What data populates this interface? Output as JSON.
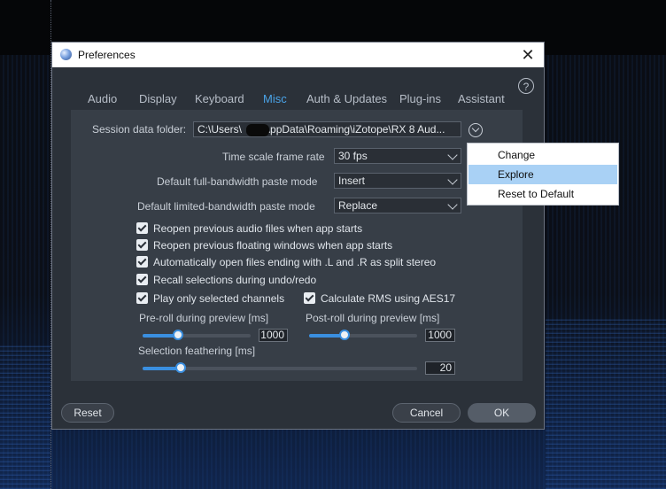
{
  "dialog": {
    "title": "Preferences",
    "close_glyph": "✕",
    "help_glyph": "?",
    "tabs": [
      {
        "label": "Audio"
      },
      {
        "label": "Display"
      },
      {
        "label": "Keyboard"
      },
      {
        "label": "Misc",
        "active": true
      },
      {
        "label": "Auth & Updates"
      },
      {
        "label": "Plug-ins"
      },
      {
        "label": "Assistant"
      }
    ]
  },
  "misc": {
    "session_folder_label": "Session data folder:",
    "session_folder_value_pre": "C:\\Users\\",
    "session_folder_value_post": "AppData\\Roaming\\iZotope\\RX 8 Aud...",
    "time_scale_label": "Time scale frame rate",
    "time_scale_value": "30 fps",
    "full_bw_label": "Default full-bandwidth paste mode",
    "full_bw_value": "Insert",
    "limited_bw_label": "Default limited-bandwidth paste mode",
    "limited_bw_value": "Replace",
    "checkboxes": [
      {
        "label": "Reopen previous audio files when app starts",
        "checked": true
      },
      {
        "label": "Reopen previous floating windows when app starts",
        "checked": true
      },
      {
        "label": "Automatically open files ending with .L and .R as split stereo",
        "checked": true
      },
      {
        "label": "Recall selections during undo/redo",
        "checked": true
      },
      {
        "label": "Play only selected channels",
        "checked": true
      },
      {
        "label": "Calculate RMS using AES17",
        "checked": true
      }
    ],
    "preroll_label": "Pre-roll during preview [ms]",
    "preroll_value": "1000",
    "preroll_fraction": 0.33,
    "postroll_label": "Post-roll during preview [ms]",
    "postroll_value": "1000",
    "postroll_fraction": 0.33,
    "feather_label": "Selection feathering [ms]",
    "feather_value": "20",
    "feather_fraction": 0.14
  },
  "footer": {
    "reset_label": "Reset",
    "cancel_label": "Cancel",
    "ok_label": "OK"
  },
  "context_menu": {
    "items": [
      {
        "label": "Change"
      },
      {
        "label": "Explore",
        "highlighted": true
      },
      {
        "label": "Reset to Default"
      }
    ]
  },
  "colors": {
    "accent": "#3a8fe0",
    "active_tab": "#4aa3e8",
    "dialog_bg": "#2b3139",
    "panel_bg": "#373e47",
    "menu_highlight": "#a9d1f5"
  },
  "icons": {
    "app": "izotope-app-icon",
    "folder_menu": "chevron-down-circle-icon"
  }
}
